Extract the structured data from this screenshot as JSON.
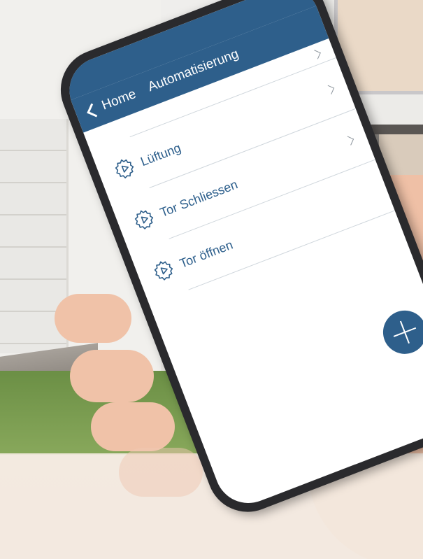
{
  "nav": {
    "back_label": "Home",
    "title": "Automatisierung"
  },
  "list": {
    "items": [
      {
        "label": "",
        "icon": "chevron-right-icon"
      },
      {
        "label": "Lüftung",
        "icon": "automation-gear-play-icon"
      },
      {
        "label": "Tor Schliessen",
        "icon": "automation-gear-play-icon"
      },
      {
        "label": "Tor öffnen",
        "icon": "automation-gear-play-icon"
      }
    ]
  },
  "fab": {
    "icon": "plus-icon"
  },
  "colors": {
    "accent": "#2e5f8b",
    "label_text": "#2d5f8c",
    "divider": "#cfd6dc"
  }
}
